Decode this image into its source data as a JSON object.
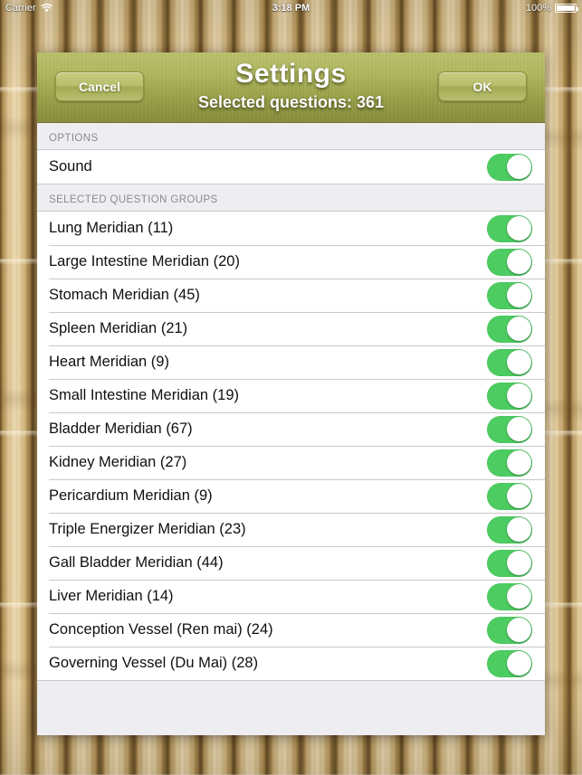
{
  "status_bar": {
    "carrier": "Carrier",
    "wifi_icon": "wifi-icon",
    "time": "3:18 PM",
    "battery_percent": "100%",
    "battery_icon": "battery-icon"
  },
  "header": {
    "title": "Settings",
    "subtitle": "Selected questions: 361",
    "cancel_label": "Cancel",
    "ok_label": "OK"
  },
  "sections": [
    {
      "header": "OPTIONS",
      "rows": [
        {
          "label": "Sound",
          "toggle": "on"
        }
      ]
    },
    {
      "header": "SELECTED QUESTION GROUPS",
      "rows": [
        {
          "label": "Lung Meridian (11)",
          "toggle": "on"
        },
        {
          "label": "Large Intestine Meridian (20)",
          "toggle": "on"
        },
        {
          "label": "Stomach Meridian (45)",
          "toggle": "on"
        },
        {
          "label": "Spleen Meridian (21)",
          "toggle": "on"
        },
        {
          "label": "Heart Meridian (9)",
          "toggle": "on"
        },
        {
          "label": "Small Intestine Meridian (19)",
          "toggle": "on"
        },
        {
          "label": "Bladder Meridian (67)",
          "toggle": "on"
        },
        {
          "label": "Kidney Meridian (27)",
          "toggle": "on"
        },
        {
          "label": "Pericardium Meridian (9)",
          "toggle": "on"
        },
        {
          "label": "Triple Energizer Meridian (23)",
          "toggle": "on"
        },
        {
          "label": "Gall Bladder Meridian (44)",
          "toggle": "on"
        },
        {
          "label": "Liver Meridian (14)",
          "toggle": "on"
        },
        {
          "label": "Conception Vessel (Ren mai) (24)",
          "toggle": "on"
        },
        {
          "label": "Governing Vessel (Du Mai) (28)",
          "toggle": "on"
        }
      ]
    }
  ],
  "colors": {
    "header_gradient_top": "#b9c069",
    "header_gradient_bottom": "#868b39",
    "toggle_on": "#4ccc61",
    "panel_background": "#eeedf2",
    "row_background": "#ffffff",
    "section_header_text": "#8a8a90"
  }
}
